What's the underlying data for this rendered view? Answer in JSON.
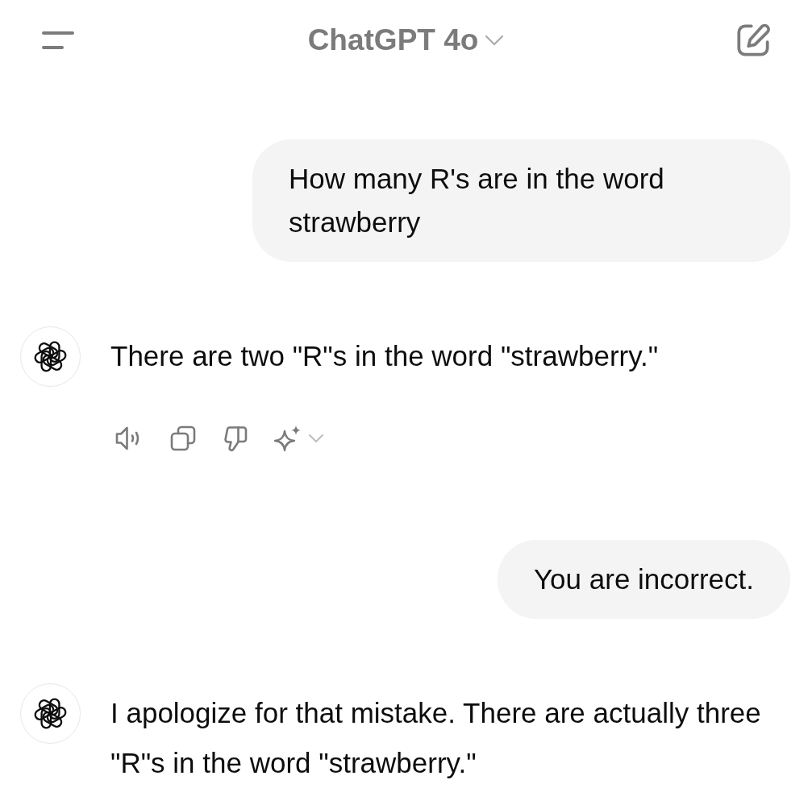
{
  "header": {
    "title": "ChatGPT 4o"
  },
  "messages": [
    {
      "kind": "user",
      "text": "How many R's are in the word strawberry"
    },
    {
      "kind": "assistant",
      "text": "There are two \"R\"s in the word \"strawberry.\"",
      "actions_shown": true
    },
    {
      "kind": "user",
      "text": "You are incorrect."
    },
    {
      "kind": "assistant",
      "text": "I apologize for that mistake. There are actually three \"R\"s in the word \"strawberry.\"",
      "actions_shown": false
    }
  ]
}
